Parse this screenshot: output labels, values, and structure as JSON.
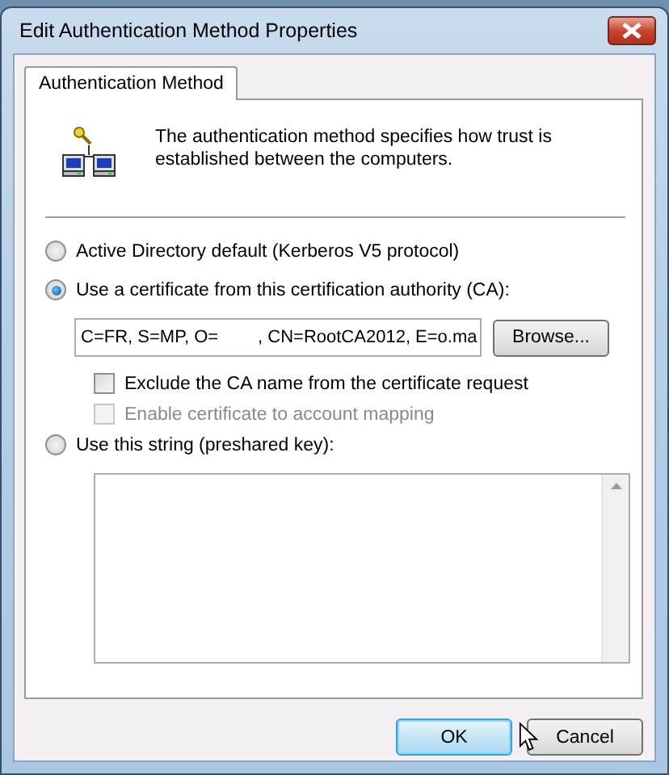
{
  "window": {
    "title": "Edit Authentication Method Properties"
  },
  "tabs": [
    {
      "label": "Authentication Method",
      "selected": true
    }
  ],
  "description": "The authentication method specifies how trust is established between the computers.",
  "options": [
    {
      "kind": "radio",
      "label": "Active Directory default (Kerberos V5 protocol)",
      "selected": false
    },
    {
      "kind": "radio",
      "label": "Use a certificate from this certification authority (CA):",
      "selected": true
    },
    {
      "kind": "certificate",
      "value": "C=FR, S=MP, O=        , CN=RootCA2012, E=o.ma",
      "button": "Browse..."
    },
    {
      "kind": "checkbox",
      "label": "Exclude the CA name from the certificate request",
      "checked": false,
      "disabled": false
    },
    {
      "kind": "checkbox",
      "label": "Enable certificate to account mapping",
      "checked": false,
      "disabled": true
    },
    {
      "kind": "radio",
      "label": "Use this string (preshared key):",
      "selected": false
    },
    {
      "kind": "textarea"
    }
  ],
  "buttons": [
    {
      "label": "OK",
      "default": true
    },
    {
      "label": "Cancel",
      "default": false
    }
  ]
}
